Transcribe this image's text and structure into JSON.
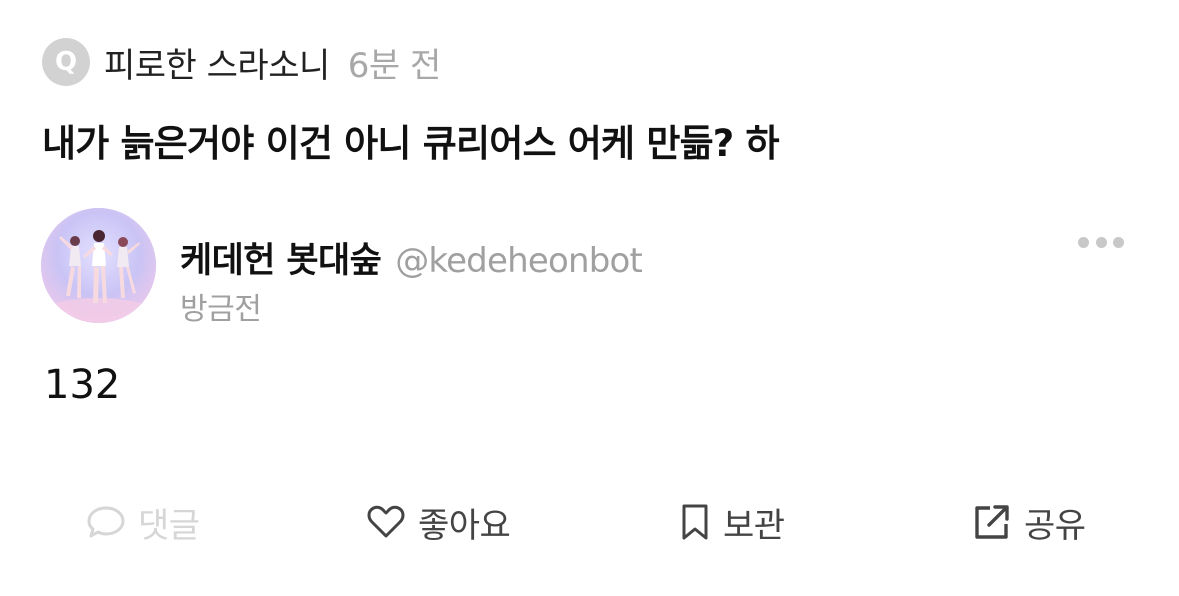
{
  "question": {
    "badge_letter": "Q",
    "author": "피로한 스라소니",
    "time": "6분 전",
    "text": "내가 늙은거야 이건 아니 큐리어스 어케 만듦? 하"
  },
  "answer": {
    "display_name": "케데헌 봇대숲",
    "handle": "@kedeheonbot",
    "time": "방금전",
    "body": "132",
    "avatar_icon": "profile-avatar"
  },
  "actions": {
    "comment": {
      "label": "댓글",
      "icon": "comment-icon",
      "color": "#d6d6d6"
    },
    "like": {
      "label": "좋아요",
      "icon": "heart-icon",
      "color": "#444444"
    },
    "save": {
      "label": "보관",
      "icon": "bookmark-icon",
      "color": "#444444"
    },
    "share": {
      "label": "공유",
      "icon": "share-icon",
      "color": "#444444"
    }
  },
  "colors": {
    "badge_bg": "#d2d2d2",
    "muted_text": "#a0a0a0",
    "primary_text": "#111111"
  }
}
